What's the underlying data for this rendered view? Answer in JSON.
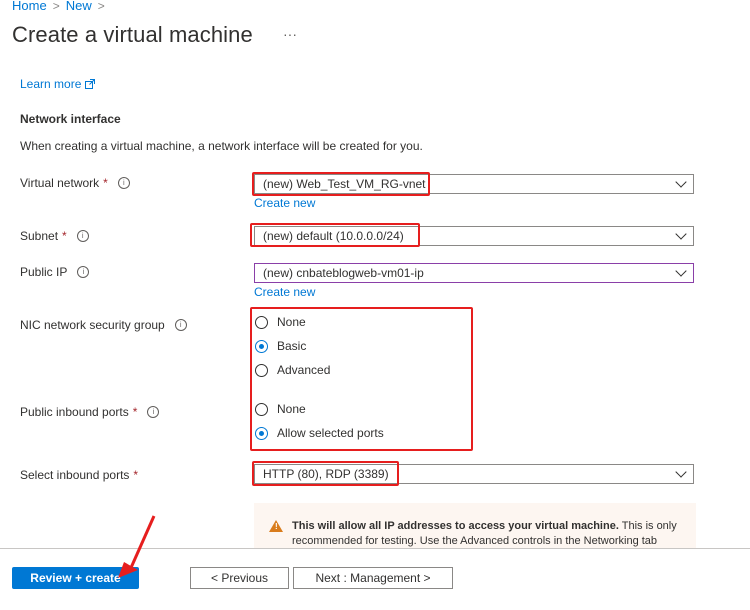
{
  "breadcrumb": [
    {
      "label": "Home"
    },
    {
      "label": "New"
    }
  ],
  "breadcrumb_separator": ">",
  "page": {
    "title": "Create a virtual machine",
    "more_label": "···"
  },
  "learn_more": {
    "label": "Learn more",
    "icon": "external-link-icon"
  },
  "network_interface": {
    "heading": "Network interface",
    "description": "When creating a virtual machine, a network interface will be created for you."
  },
  "fields": {
    "virtual_network": {
      "label": "Virtual network",
      "required": "*",
      "value": "(new) Web_Test_VM_RG-vnet",
      "create_new": "Create new"
    },
    "subnet": {
      "label": "Subnet",
      "required": "*",
      "value": "(new) default (10.0.0.0/24)"
    },
    "public_ip": {
      "label": "Public IP",
      "value": "(new) cnbateblogweb-vm01-ip",
      "create_new": "Create new"
    },
    "nic_nsg": {
      "label": "NIC network security group",
      "options": [
        {
          "label": "None",
          "selected": false
        },
        {
          "label": "Basic",
          "selected": true
        },
        {
          "label": "Advanced",
          "selected": false
        }
      ]
    },
    "public_inbound_ports": {
      "label": "Public inbound ports",
      "required": "*",
      "options": [
        {
          "label": "None",
          "selected": false
        },
        {
          "label": "Allow selected ports",
          "selected": true
        }
      ]
    },
    "select_inbound_ports": {
      "label": "Select inbound ports",
      "required": "*",
      "value": "HTTP (80), RDP (3389)"
    }
  },
  "warning": {
    "bold": "This will allow all IP addresses to access your virtual machine.",
    "text_line1": " This is only",
    "text_line2": "recommended for testing.  Use the Advanced controls in the Networking tab"
  },
  "footer": {
    "review_create": "Review + create",
    "previous": "< Previous",
    "next": "Next : Management >"
  },
  "colors": {
    "accent": "#0078d4",
    "annotation_red": "#e61e1e",
    "warning_orange": "#d97c1c"
  }
}
